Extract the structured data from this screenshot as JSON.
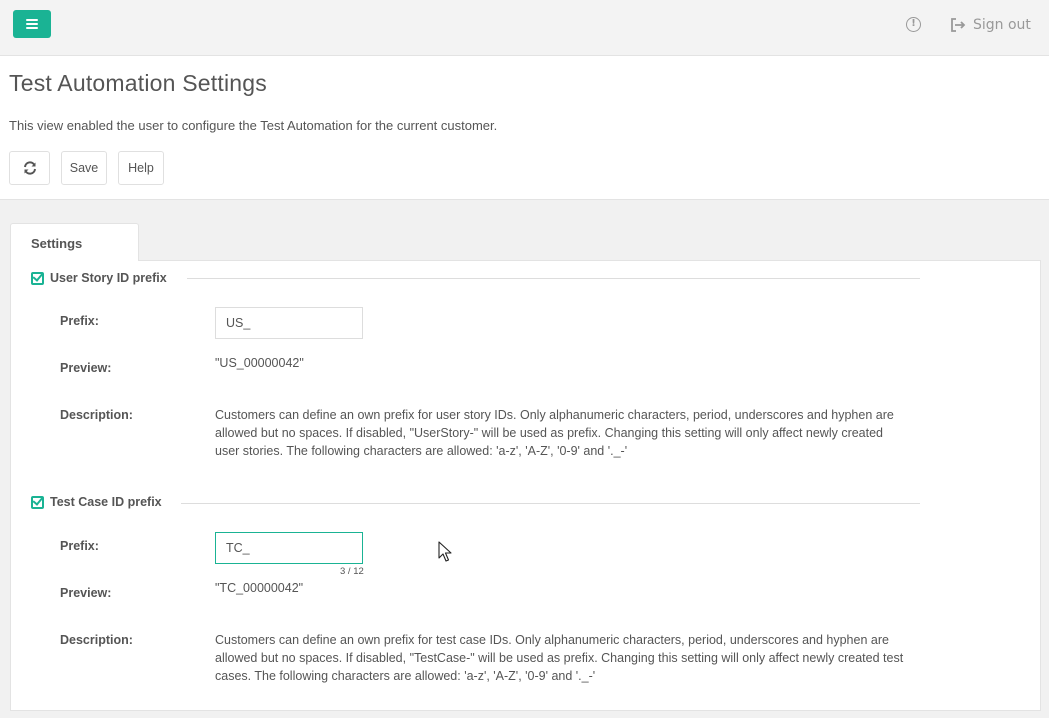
{
  "topbar": {
    "menu_icon": "hamburger-icon",
    "alert_icon": "exclamation-circle-icon",
    "alert_glyph": "!",
    "signout_icon": "sign-out-icon",
    "signout_label": "Sign out"
  },
  "header": {
    "title": "Test Automation Settings",
    "description": "This view enabled the user to configure the Test Automation for the current customer.",
    "refresh_icon": "refresh-icon",
    "save_label": "Save",
    "help_label": "Help"
  },
  "tabs": [
    {
      "label": "Settings"
    }
  ],
  "sections": [
    {
      "title": "User Story ID prefix",
      "checked": true,
      "prefix_label": "Prefix:",
      "prefix_value": "US_",
      "preview_label": "Preview:",
      "preview_value": "\"US_00000042\"",
      "description_label": "Description:",
      "description": "Customers can define an own prefix for user story IDs. Only alphanumeric characters, period, underscores and hyphen are allowed but no spaces. If disabled, \"UserStory-\" will be used as prefix. Changing this setting will only affect newly created user stories. The following characters are allowed: 'a-z', 'A-Z', '0-9' and '._-'"
    },
    {
      "title": "Test Case ID prefix",
      "checked": true,
      "prefix_label": "Prefix:",
      "prefix_value": "TC_",
      "char_counter": "3 / 12",
      "preview_label": "Preview:",
      "preview_value": "\"TC_00000042\"",
      "description_label": "Description:",
      "description": "Customers can define an own prefix for test case IDs. Only alphanumeric characters, period, underscores and hyphen are allowed but no spaces. If disabled, \"TestCase-\" will be used as prefix. Changing this setting will only affect newly created test cases. The following characters are allowed: 'a-z', 'A-Z', '0-9' and '._-'"
    }
  ],
  "colors": {
    "accent": "#1ab394",
    "text": "#555555",
    "muted": "#999999"
  }
}
